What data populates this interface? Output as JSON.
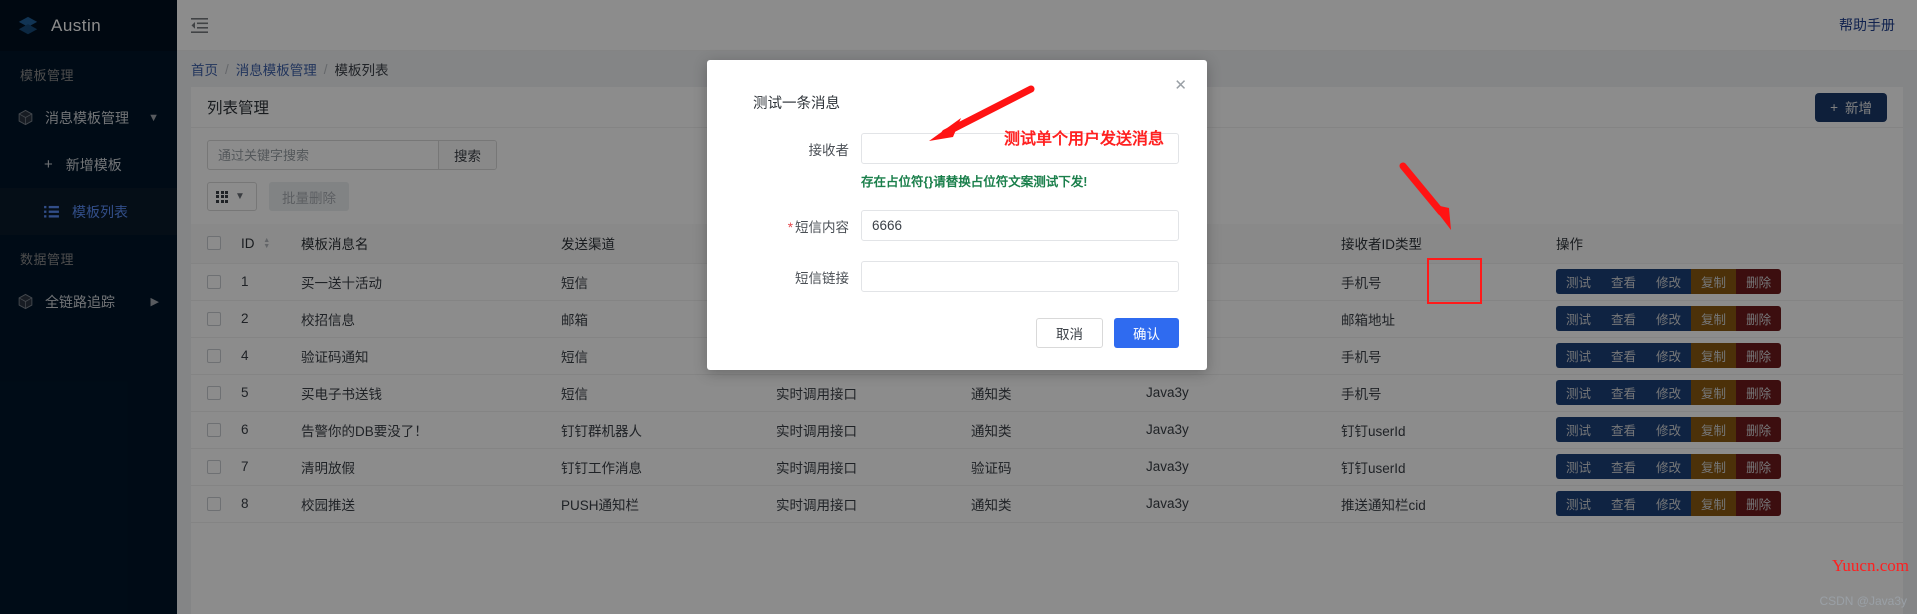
{
  "sidebar": {
    "brand": "Austin",
    "groups": [
      {
        "title": "模板管理",
        "items": [
          {
            "label": "消息模板管理",
            "icon": "cube-icon",
            "expandable": true
          },
          {
            "label": "新增模板",
            "icon": "plus-icon",
            "sub": true
          },
          {
            "label": "模板列表",
            "icon": "list-icon",
            "sub": true,
            "active": true
          }
        ]
      },
      {
        "title": "数据管理",
        "items": [
          {
            "label": "全链路追踪",
            "icon": "cube-icon",
            "expandable": true
          }
        ]
      }
    ]
  },
  "topbar": {
    "collapse_icon": "menu-collapse-icon",
    "help_link": "帮助手册"
  },
  "breadcrumb": {
    "home": "首页",
    "sep": "/",
    "parent": "消息模板管理",
    "current": "模板列表"
  },
  "card": {
    "title": "列表管理",
    "add_button": "新增",
    "add_icon": "plus-icon"
  },
  "toolbar": {
    "search_placeholder": "通过关键字搜索",
    "search_value": "",
    "search_button": "搜索",
    "view_select_icon": "grid-icon",
    "bulk_delete": "批量删除"
  },
  "table": {
    "columns": [
      {
        "key": "chk",
        "label": ""
      },
      {
        "key": "id",
        "label": "ID",
        "sortable": true
      },
      {
        "key": "name",
        "label": "模板消息名"
      },
      {
        "key": "chan",
        "label": "发送渠道"
      },
      {
        "key": "call",
        "label": ""
      },
      {
        "key": "type",
        "label": ""
      },
      {
        "key": "user",
        "label": ""
      },
      {
        "key": "rid",
        "label": "接收者ID类型"
      },
      {
        "key": "ops",
        "label": "操作"
      }
    ],
    "ops_labels": [
      "测试",
      "查看",
      "修改",
      "复制",
      "删除"
    ],
    "rows": [
      {
        "id": "1",
        "name": "买一送十活动",
        "chan": "短信",
        "call": "",
        "type": "",
        "user": "",
        "rid": "手机号"
      },
      {
        "id": "2",
        "name": "校招信息",
        "chan": "邮箱",
        "call": "",
        "type": "",
        "user": "",
        "rid": "邮箱地址"
      },
      {
        "id": "4",
        "name": "验证码通知",
        "chan": "短信",
        "call": "实时调用接口",
        "type": "验证码",
        "user": "Java3y",
        "rid": "手机号"
      },
      {
        "id": "5",
        "name": "买电子书送钱",
        "chan": "短信",
        "call": "实时调用接口",
        "type": "通知类",
        "user": "Java3y",
        "rid": "手机号"
      },
      {
        "id": "6",
        "name": "告警你的DB要没了！",
        "chan": "钉钉群机器人",
        "call": "实时调用接口",
        "type": "通知类",
        "user": "Java3y",
        "rid": "钉钉userId"
      },
      {
        "id": "7",
        "name": "清明放假",
        "chan": "钉钉工作消息",
        "call": "实时调用接口",
        "type": "验证码",
        "user": "Java3y",
        "rid": "钉钉userId"
      },
      {
        "id": "8",
        "name": "校园推送",
        "chan": "PUSH通知栏",
        "call": "实时调用接口",
        "type": "通知类",
        "user": "Java3y",
        "rid": "推送通知栏cid"
      }
    ]
  },
  "modal": {
    "title": "测试一条消息",
    "close_icon": "close-icon",
    "fields": [
      {
        "label": "接收者",
        "value": "",
        "required": false
      },
      {
        "label": "短信内容",
        "value": "6666",
        "required": true
      },
      {
        "label": "短信链接",
        "value": "",
        "required": false
      }
    ],
    "hint": "存在占位符{}请替换占位符文案测试下发!",
    "cancel": "取消",
    "confirm": "确认"
  },
  "annotations": {
    "callout_text": "测试单个用户发送消息",
    "arrow_icon": "red-arrow-icon",
    "highlight_box_icon": "red-rectangle-icon"
  },
  "watermark": {
    "site": "Yuucn.com",
    "credit": "CSDN @Java3y"
  },
  "colors": {
    "sidebar_bg": "#001529",
    "accent_blue": "#2f6bf0",
    "op_blue": "#1d4078",
    "op_orange": "#8a5a12",
    "op_red": "#6e1a1c",
    "hint_green": "#1a7f4b",
    "anno_red": "#ff1a1a"
  }
}
